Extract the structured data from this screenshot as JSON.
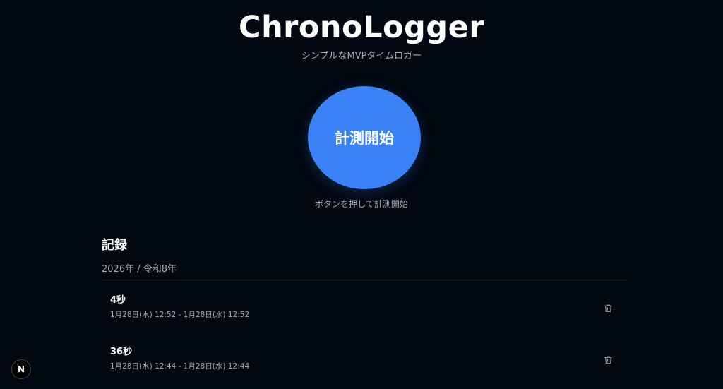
{
  "header": {
    "title": "ChronoLogger",
    "subtitle": "シンプルなMVPタイムロガー"
  },
  "timer": {
    "start_label": "計測開始",
    "hint": "ボタンを押して計測開始"
  },
  "records": {
    "heading": "記録",
    "year_label": "2026年 / 令和8年",
    "items": [
      {
        "duration": "4秒",
        "range": "1月28日(水) 12:52 - 1月28日(水) 12:52"
      },
      {
        "duration": "36秒",
        "range": "1月28日(水) 12:44 - 1月28日(水) 12:44"
      }
    ]
  },
  "dev_badge": {
    "label": "N"
  },
  "colors": {
    "background": "#020812",
    "accent": "#3b82f6",
    "muted_text": "#a3a9b6"
  },
  "icons": {
    "delete": "trash-icon"
  }
}
